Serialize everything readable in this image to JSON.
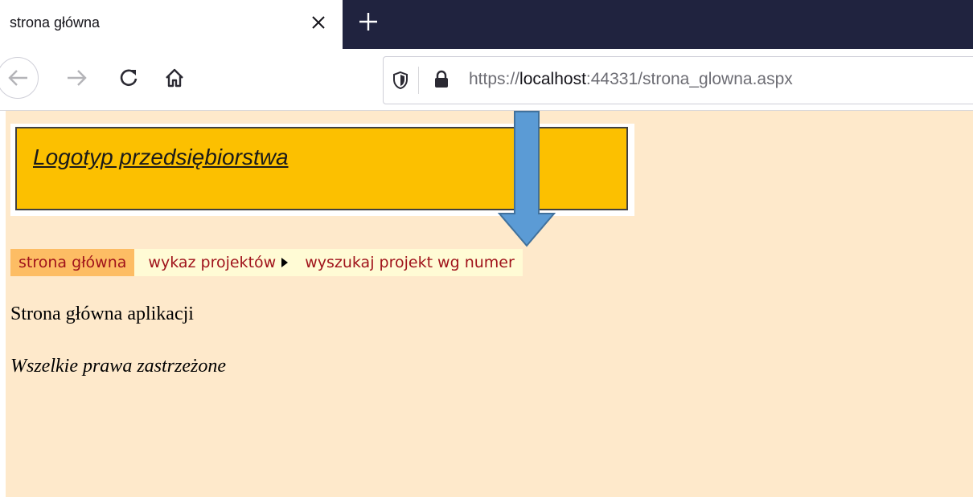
{
  "browser": {
    "tab": {
      "title": "strona główna"
    },
    "url": {
      "scheme": "https://",
      "host": "localhost",
      "rest": ":44331/strona_glowna.aspx"
    }
  },
  "page": {
    "logo_text": "Logotyp przedsiębiorstwa",
    "menu": [
      {
        "label": "strona główna",
        "active": true
      },
      {
        "label": "wykaz projektów",
        "has_submenu": true
      },
      {
        "label": "wyszukaj projekt wg numer"
      }
    ],
    "welcome_text": "Strona główna aplikacji",
    "footer_text": "Wszelkie prawa zastrzeżone"
  },
  "colors": {
    "page_background": "#fee9cb",
    "logo_background": "#fcc000",
    "menu_active": "#fdbd64",
    "menu_background": "#fffbd5",
    "menu_text": "#a0131b",
    "annotation_arrow": "#5b9bd5",
    "tabbar": "#20233f"
  }
}
